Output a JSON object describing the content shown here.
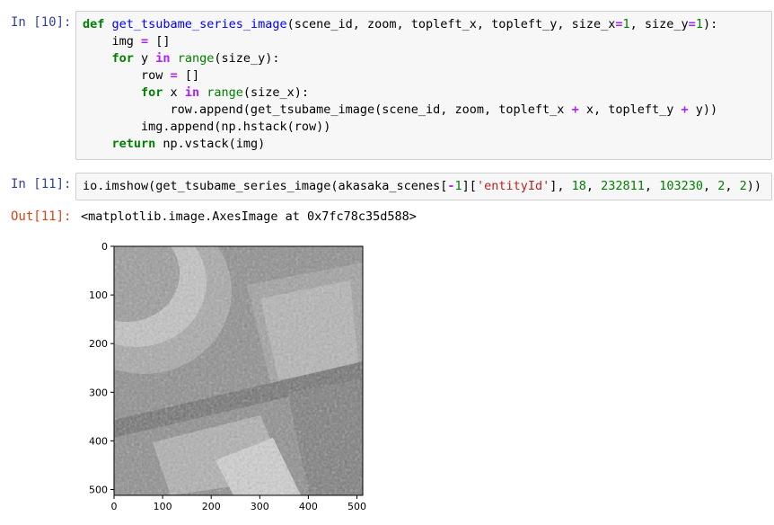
{
  "cell10": {
    "prompt": "In [10]:",
    "lines": [
      [
        {
          "t": "def",
          "c": "kw"
        },
        {
          "t": " "
        },
        {
          "t": "get_tsubame_series_image",
          "c": "fn"
        },
        {
          "t": "(scene_id, zoom, topleft_x, topleft_y, size_x"
        },
        {
          "t": "=",
          "c": "op"
        },
        {
          "t": "1",
          "c": "nm"
        },
        {
          "t": ", size_y"
        },
        {
          "t": "=",
          "c": "op"
        },
        {
          "t": "1",
          "c": "nm"
        },
        {
          "t": "):"
        }
      ],
      [
        {
          "t": "    img "
        },
        {
          "t": "=",
          "c": "op"
        },
        {
          "t": " []"
        }
      ],
      [
        {
          "t": "    "
        },
        {
          "t": "for",
          "c": "kw"
        },
        {
          "t": " y "
        },
        {
          "t": "in",
          "c": "op"
        },
        {
          "t": " "
        },
        {
          "t": "range",
          "c": "bi"
        },
        {
          "t": "(size_y):"
        }
      ],
      [
        {
          "t": "        row "
        },
        {
          "t": "=",
          "c": "op"
        },
        {
          "t": " []"
        }
      ],
      [
        {
          "t": "        "
        },
        {
          "t": "for",
          "c": "kw"
        },
        {
          "t": " x "
        },
        {
          "t": "in",
          "c": "op"
        },
        {
          "t": " "
        },
        {
          "t": "range",
          "c": "bi"
        },
        {
          "t": "(size_x):"
        }
      ],
      [
        {
          "t": "            row.append(get_tsubame_image(scene_id, zoom, topleft_x "
        },
        {
          "t": "+",
          "c": "op"
        },
        {
          "t": " x, topleft_y "
        },
        {
          "t": "+",
          "c": "op"
        },
        {
          "t": " y))"
        }
      ],
      [
        {
          "t": "        img.append(np.hstack(row))"
        }
      ],
      [
        {
          "t": "    "
        },
        {
          "t": "return",
          "c": "kw"
        },
        {
          "t": " np.vstack(img)"
        }
      ]
    ]
  },
  "cell11": {
    "prompt": "In [11]:",
    "lines": [
      [
        {
          "t": "io.imshow(get_tsubame_series_image(akasaka_scenes["
        },
        {
          "t": "-",
          "c": "op"
        },
        {
          "t": "1",
          "c": "nm"
        },
        {
          "t": "]["
        },
        {
          "t": "'entityId'",
          "c": "st"
        },
        {
          "t": "], "
        },
        {
          "t": "18",
          "c": "nm"
        },
        {
          "t": ", "
        },
        {
          "t": "232811",
          "c": "nm"
        },
        {
          "t": ", "
        },
        {
          "t": "103230",
          "c": "nm"
        },
        {
          "t": ", "
        },
        {
          "t": "2",
          "c": "nm"
        },
        {
          "t": ", "
        },
        {
          "t": "2",
          "c": "nm"
        },
        {
          "t": "))"
        }
      ]
    ],
    "out_prompt": "Out[11]:",
    "output_text": "<matplotlib.image.AxesImage at 0x7fc78c35d588>"
  },
  "plot": {
    "x_ticks": [
      "0",
      "100",
      "200",
      "300",
      "400",
      "500"
    ],
    "y_ticks": [
      "0",
      "100",
      "200",
      "300",
      "400",
      "500"
    ],
    "xlim": [
      0,
      512
    ],
    "ylim": [
      0,
      512
    ],
    "colors": {
      "image_base": "#8c8c8c",
      "axis": "#000000"
    }
  }
}
